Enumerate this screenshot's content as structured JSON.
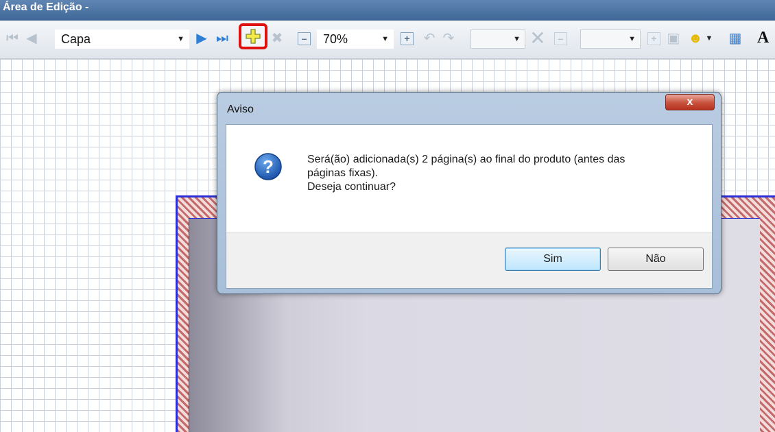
{
  "window": {
    "title": "Área de Edição -"
  },
  "toolbar": {
    "page_select": {
      "value": "Capa"
    },
    "zoom_select": {
      "value": "70%"
    },
    "text_tool_label": "A"
  },
  "dialog": {
    "title": "Aviso",
    "close_label": "x",
    "message_lines": [
      "Será(ão) adicionada(s) 2 página(s) ao final do produto (antes das",
      "páginas fixas).",
      "Deseja continuar?"
    ],
    "buttons": {
      "yes": "Sim",
      "no": "Não"
    }
  },
  "colors": {
    "highlight_border": "#e01010",
    "page_border": "#2a2fd3",
    "hatch": "#c46a6a",
    "titlebar": "#4a72a3"
  }
}
